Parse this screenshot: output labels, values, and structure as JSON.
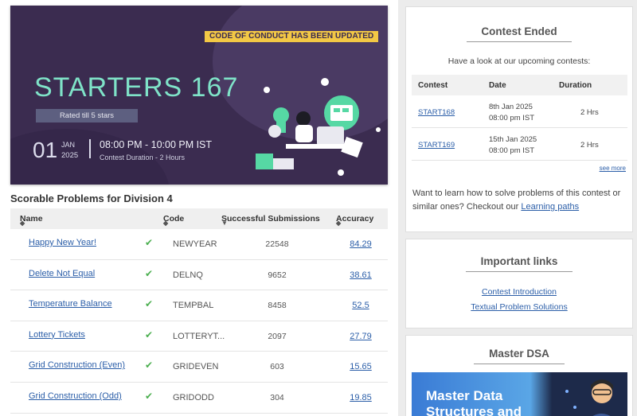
{
  "banner": {
    "notice": "CODE OF CONDUCT HAS BEEN UPDATED",
    "title": "STARTERS 167",
    "rated": "Rated till 5 stars",
    "day": "01",
    "month": "JAN",
    "year": "2025",
    "time": "08:00 PM - 10:00 PM IST",
    "duration": "Contest Duration - 2 Hours"
  },
  "problems": {
    "title": "Scorable Problems for Division 4",
    "headers": {
      "name": "Name",
      "code": "Code",
      "submissions": "Successful Submissions",
      "accuracy": "Accuracy"
    },
    "rows": [
      {
        "name": "Happy New Year!",
        "code": "NEWYEAR",
        "submissions": "22548",
        "accuracy": "84.29"
      },
      {
        "name": "Delete Not Equal",
        "code": "DELNQ",
        "submissions": "9652",
        "accuracy": "38.61"
      },
      {
        "name": "Temperature Balance",
        "code": "TEMPBAL",
        "submissions": "8458",
        "accuracy": "52.5"
      },
      {
        "name": "Lottery Tickets",
        "code": "LOTTERYT...",
        "submissions": "2097",
        "accuracy": "27.79"
      },
      {
        "name": "Grid Construction (Even)",
        "code": "GRIDEVEN",
        "submissions": "603",
        "accuracy": "15.65"
      },
      {
        "name": "Grid Construction (Odd)",
        "code": "GRIDODD",
        "submissions": "304",
        "accuracy": "19.85"
      }
    ]
  },
  "contest_ended": {
    "title": "Contest Ended",
    "subtitle": "Have a look at our upcoming contests:",
    "headers": {
      "contest": "Contest",
      "date": "Date",
      "duration": "Duration"
    },
    "rows": [
      {
        "contest": "START168",
        "date": "8th Jan 2025",
        "time": "08:00 pm IST",
        "duration": "2 Hrs"
      },
      {
        "contest": "START169",
        "date": "15th Jan 2025",
        "time": "08:00 pm IST",
        "duration": "2 Hrs"
      }
    ],
    "see_more": "see more",
    "learn_text": "Want to learn how to solve problems of this contest or similar ones? Checkout our",
    "learn_link": "Learning paths"
  },
  "important_links": {
    "title": "Important links",
    "links": [
      "Contest Introduction",
      "Textual Problem Solutions"
    ]
  },
  "master_dsa": {
    "title": "Master DSA",
    "banner_line1": "Master Data",
    "banner_line2": "Structures and"
  },
  "colors": {
    "banner_bg": "#3b2c50",
    "title_teal": "#7fe3c8",
    "notice_yellow": "#f3c845",
    "link_blue": "#2b5ea8",
    "tick_green": "#4caf50"
  }
}
